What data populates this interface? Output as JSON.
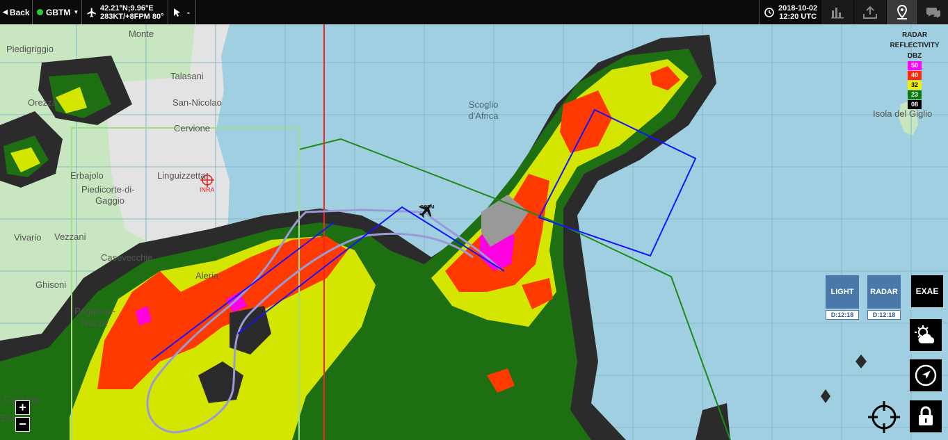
{
  "topbar": {
    "back_label": "Back",
    "aircraft_id": "GBTM",
    "position": "42.21°N;9.96°E",
    "speed_line": "283KT/+8FPM 80°",
    "cursor_mode": "-",
    "date": "2018-10-02",
    "time": "12:20 UTC"
  },
  "map": {
    "places": [
      {
        "name": "Monte",
        "type": "land"
      },
      {
        "name": "Piedigriggio",
        "type": "land"
      },
      {
        "name": "Talasani",
        "type": "land"
      },
      {
        "name": "San-Nicolao",
        "type": "land"
      },
      {
        "name": "Cervione",
        "type": "land"
      },
      {
        "name": "Orezza",
        "type": "land"
      },
      {
        "name": "Erbajolo",
        "type": "land"
      },
      {
        "name": "Linguizzetta",
        "type": "land"
      },
      {
        "name": "Piedicorte-di-",
        "type": "land"
      },
      {
        "name": "Gaggio",
        "type": "land"
      },
      {
        "name": "Vivario",
        "type": "land"
      },
      {
        "name": "Vezzani",
        "type": "land"
      },
      {
        "name": "Casevecchie",
        "type": "land"
      },
      {
        "name": "Ghisoni",
        "type": "land"
      },
      {
        "name": "Aleria",
        "type": "land"
      },
      {
        "name": "Poggio-di-",
        "type": "land"
      },
      {
        "name": "Nazza",
        "type": "land"
      },
      {
        "name": "Cozzano",
        "type": "land"
      },
      {
        "name": "Zicavo",
        "type": "land"
      },
      {
        "name": "Scoglio",
        "type": "sea"
      },
      {
        "name": "d'Africa",
        "type": "sea"
      },
      {
        "name": "Isola del Giglio",
        "type": "land"
      }
    ],
    "airport_label": "INRA",
    "aircraft_label": "GBTM"
  },
  "legend": {
    "title_1": "RADAR",
    "title_2": "REFLECTIVITY",
    "unit": "DBZ",
    "levels": [
      {
        "value": "50",
        "color": "#ff00ff"
      },
      {
        "value": "40",
        "color": "#ff2a00"
      },
      {
        "value": "32",
        "color": "#eef000"
      },
      {
        "value": "23",
        "color": "#0a7a0a"
      },
      {
        "value": "08",
        "color": "#000000"
      }
    ]
  },
  "layers": [
    {
      "label": "LIGHT",
      "time": "D:12:18"
    },
    {
      "label": "RADAR",
      "time": "D:12:18"
    }
  ],
  "exae_label": "EXAE",
  "zoom": {
    "in": "+",
    "out": "−"
  },
  "colors": {
    "sea": "#9fcfe0",
    "land": "#e3e3e3",
    "land_green": "#c8e6bf",
    "radar_outer": "#2b2b2b",
    "radar_low": "#1e6e12",
    "radar_mid": "#d4e600",
    "radar_high": "#ff3a00",
    "radar_extreme": "#ff00e0",
    "route_blue": "#1414ff",
    "route_lilac": "#9a9ad8",
    "sector_green": "#1a8a1a",
    "meridian_red": "#ff2020"
  }
}
